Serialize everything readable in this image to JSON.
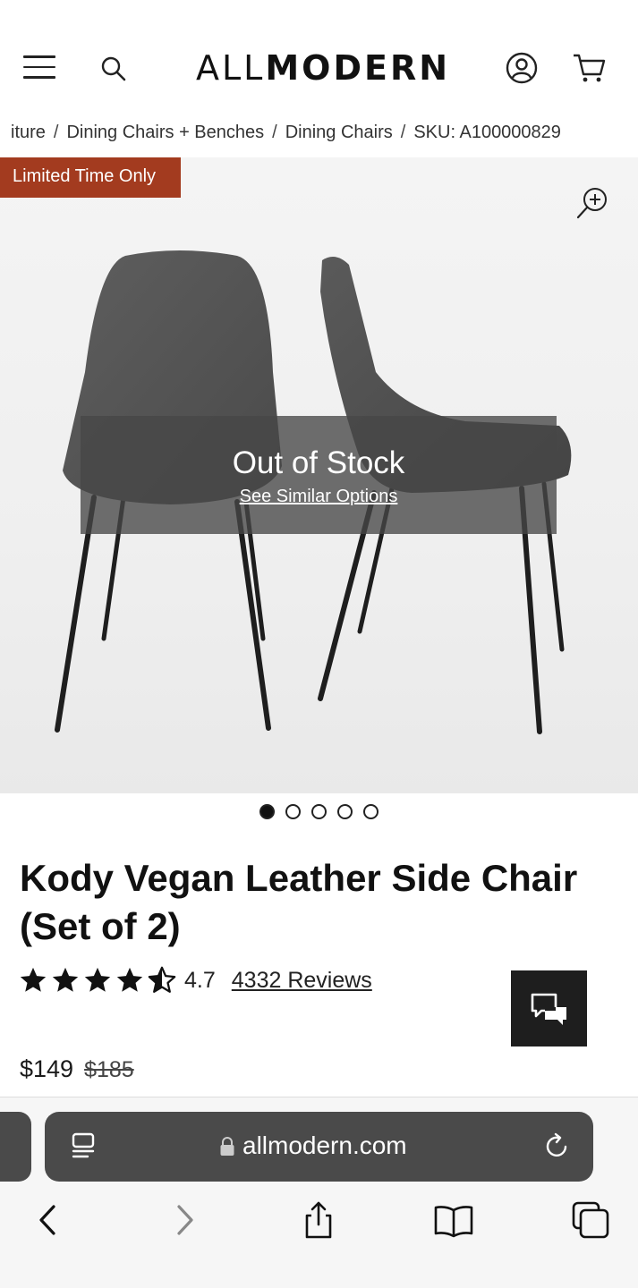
{
  "header": {
    "logo_light": "ALL",
    "logo_bold": "MODERN"
  },
  "breadcrumb": {
    "items": [
      "iture",
      "Dining Chairs + Benches",
      "Dining Chairs",
      "SKU: A100000829"
    ],
    "separator": "/"
  },
  "product_image": {
    "badge": "Limited Time Only",
    "out_of_stock_title": "Out of Stock",
    "see_similar_link": "See Similar Options",
    "carousel_total": 5,
    "carousel_active": 0
  },
  "product": {
    "title": "Kody Vegan Leather Side Chair (Set of 2)",
    "rating": 4.7,
    "rating_text": "4.7",
    "reviews_link": "4332 Reviews",
    "price": "$149",
    "original_price": "$185"
  },
  "browser": {
    "url": "allmodern.com"
  },
  "colors": {
    "badge": "#a33b1f",
    "url_bar": "#4a4a4a",
    "chat_button": "#1e1e1e"
  },
  "icons": [
    "hamburger-menu-icon",
    "search-icon",
    "account-icon",
    "cart-icon",
    "zoom-in-icon",
    "star-icon",
    "chat-icon",
    "reader-icon",
    "lock-icon",
    "reload-icon",
    "back-icon",
    "forward-icon",
    "share-icon",
    "bookmarks-icon",
    "tabs-icon"
  ]
}
